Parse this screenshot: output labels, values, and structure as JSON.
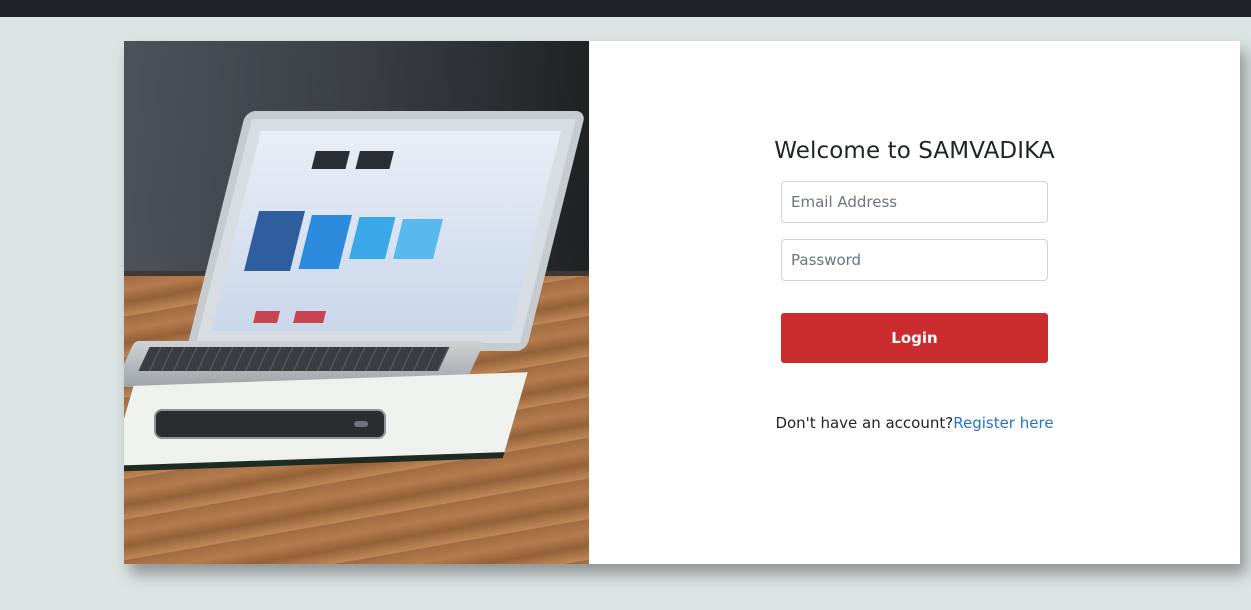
{
  "page": {
    "title": "Welcome to SAMVADIKA"
  },
  "form": {
    "email_placeholder": "Email Address",
    "password_placeholder": "Password",
    "login_label": "Login",
    "register_prompt": "Don't have an account?",
    "register_link": "Register here"
  },
  "colors": {
    "top_bar": "#1f2226",
    "background": "#dce3e3",
    "login_button": "#cb2d2f",
    "link": "#2372d6"
  }
}
